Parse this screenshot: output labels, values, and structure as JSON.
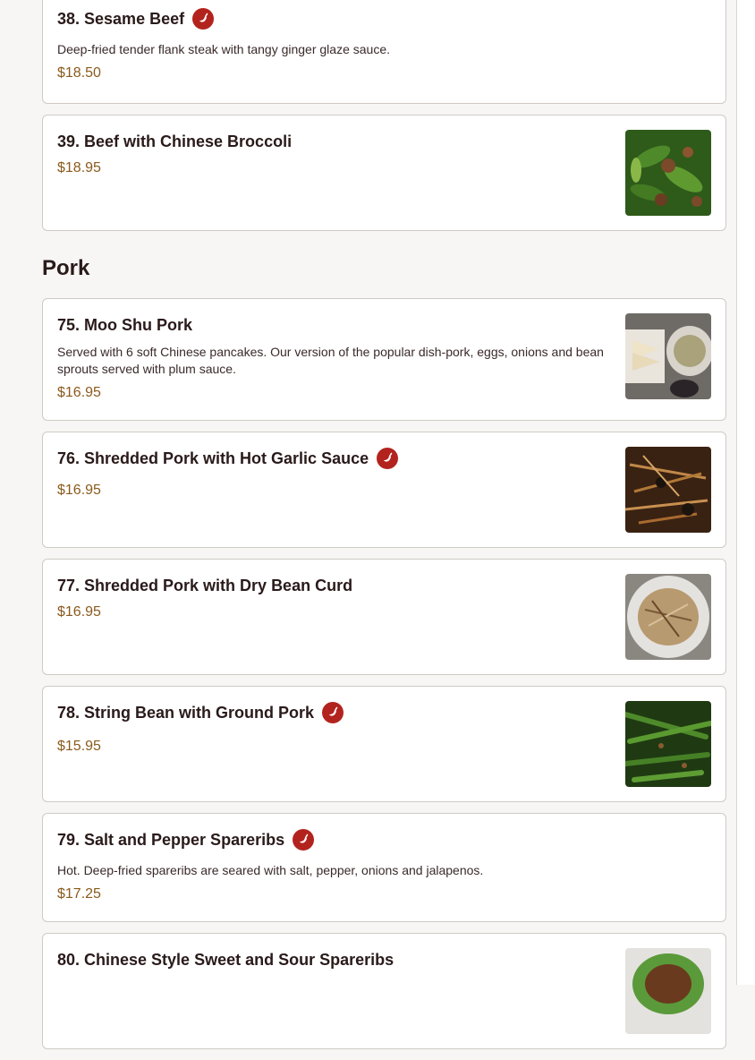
{
  "sections": [
    {
      "items": [
        {
          "title": "38. Sesame Beef",
          "spicy": true,
          "description": "Deep-fried tender flank steak with tangy ginger glaze sauce.",
          "price": "$18.50",
          "image": null
        },
        {
          "title": "39. Beef with Chinese Broccoli",
          "spicy": false,
          "description": "",
          "price": "$18.95",
          "image": "beef-broccoli"
        }
      ]
    },
    {
      "heading": "Pork",
      "items": [
        {
          "title": "75. Moo Shu Pork",
          "spicy": false,
          "description": "Served with 6 soft Chinese pancakes. Our version of the popular dish-pork, eggs, onions and bean sprouts served with plum sauce.",
          "price": "$16.95",
          "image": "moo-shu"
        },
        {
          "title": "76. Shredded Pork with Hot Garlic Sauce",
          "spicy": true,
          "description": "",
          "price": "$16.95",
          "image": "garlic-pork"
        },
        {
          "title": "77. Shredded Pork with Dry Bean Curd",
          "spicy": false,
          "description": "",
          "price": "$16.95",
          "image": "bean-curd-pork"
        },
        {
          "title": "78. String Bean with Ground Pork",
          "spicy": true,
          "description": "",
          "price": "$15.95",
          "image": "string-bean"
        },
        {
          "title": "79. Salt and Pepper Spareribs",
          "spicy": true,
          "description": "Hot. Deep-fried spareribs are seared with salt, pepper, onions and jalapenos.",
          "price": "$17.25",
          "image": null
        },
        {
          "title": "80. Chinese Style Sweet and Sour Spareribs",
          "spicy": false,
          "description": "",
          "price": "",
          "image": "spareribs"
        }
      ]
    }
  ],
  "colors": {
    "accent": "#b3231e",
    "price": "#8a5a1c",
    "text": "#2a1a1a"
  },
  "icons": {
    "spicy": "chili-pepper-icon"
  }
}
